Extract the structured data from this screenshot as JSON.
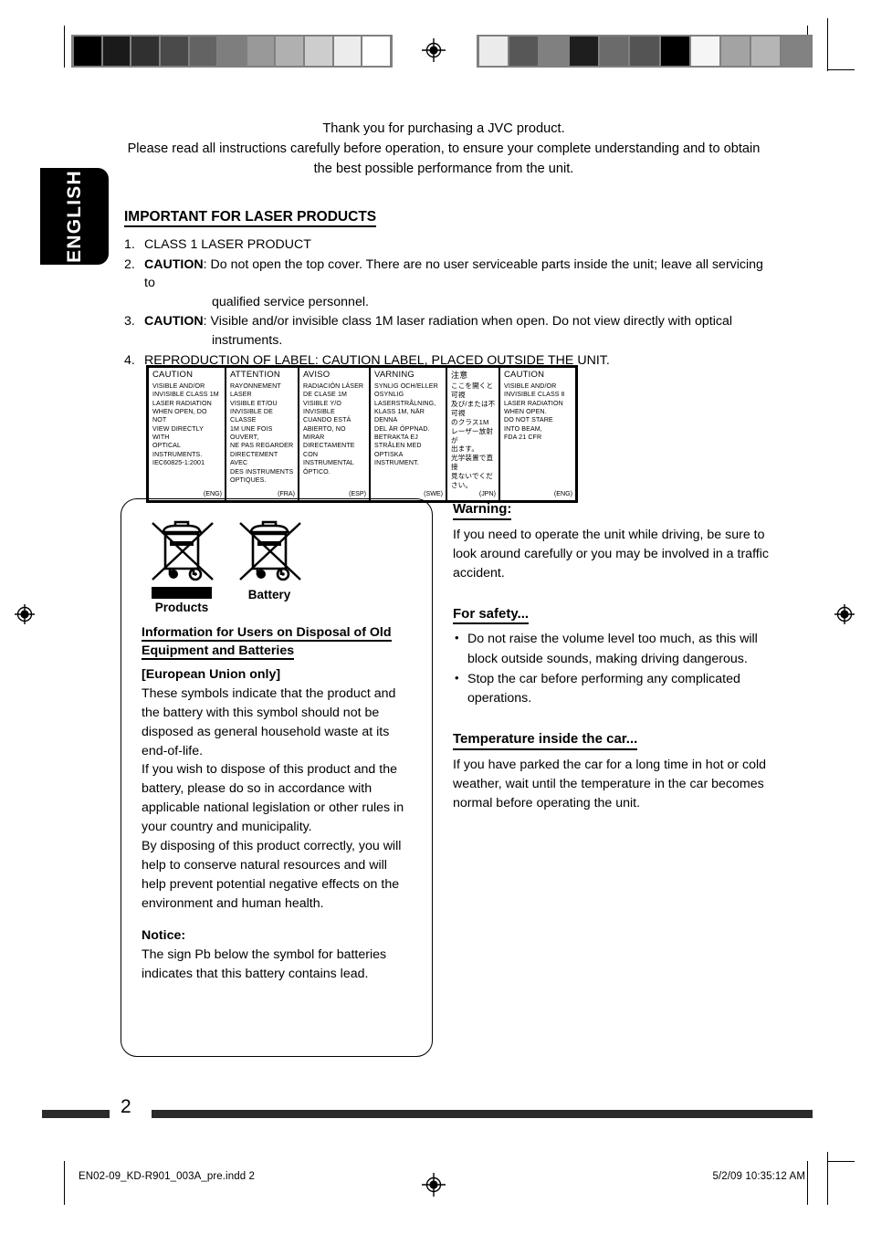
{
  "language_tab": {
    "label": "ENGLISH"
  },
  "intro": {
    "line1": "Thank you for purchasing a JVC product.",
    "line2": "Please read all instructions carefully before operation, to ensure your complete understanding and to obtain the best possible performance from the unit."
  },
  "laser_section": {
    "heading": "IMPORTANT FOR LASER PRODUCTS",
    "items": [
      {
        "num": "1.",
        "caution": "",
        "text": "CLASS 1 LASER PRODUCT",
        "indent": ""
      },
      {
        "num": "2.",
        "caution": "CAUTION",
        "text": ":   Do not open the top cover. There are no user serviceable parts inside the unit; leave all servicing to",
        "indent": "qualified service personnel."
      },
      {
        "num": "3.",
        "caution": "CAUTION",
        "text": ":   Visible and/or invisible class 1M laser radiation when open. Do not view directly with optical",
        "indent": "instruments."
      },
      {
        "num": "4.",
        "caution": "",
        "text": "REPRODUCTION OF LABEL: CAUTION LABEL, PLACED OUTSIDE THE UNIT.",
        "indent": ""
      }
    ]
  },
  "caution_label": {
    "cells": [
      {
        "title": "CAUTION",
        "body": "VISIBLE AND/OR\nINVISIBLE CLASS 1M\nLASER RADIATION\nWHEN OPEN, DO NOT\nVIEW DIRECTLY WITH\nOPTICAL INSTRUMENTS.\n  IEC60825-1:2001",
        "code": "(ENG)"
      },
      {
        "title": "ATTENTION",
        "body": "RAYONNEMENT LASER\nVISIBLE ET/OU\nINVISIBLE DE CLASSE\n1M UNE FOIS OUVERT,\nNE PAS REGARDER\nDIRECTEMENT AVEC\nDES INSTRUMENTS\nOPTIQUES.",
        "code": "(FRA)"
      },
      {
        "title": "AVISO",
        "body": "RADIACIÓN LÁSER\nDE CLASE 1M\nVISIBLE Y/O INVISIBLE\nCUANDO ESTÁ\nABIERTO, NO MIRAR\nDIRECTAMENTE\nCON INSTRUMENTAL\nÓPTICO.",
        "code": "(ESP)"
      },
      {
        "title": "VARNING",
        "body": "SYNLIG OCH/ELLER\nOSYNLIG\nLASERSTRÅLNING,\nKLASS 1M, NÄR DENNA\nDEL ÄR ÖPPNAD.\nBETRAKTA EJ\nSTRÅLEN MED OPTISKA\nINSTRUMENT.",
        "code": "(SWE)"
      },
      {
        "title": "注意",
        "body": "ここを開くと可視\n及び/または不可視\nのクラス1M\nレーザー放射が\n出ます。\n光学装置で直接\n見ないでください。",
        "code": "(JPN)"
      },
      {
        "title": "CAUTION",
        "body": "VISIBLE AND/OR\nINVISIBLE CLASS Ⅱ\nLASER RADIATION\nWHEN OPEN.\nDO NOT STARE\nINTO BEAM,\n  FDA 21 CFR",
        "code": "(ENG)"
      }
    ]
  },
  "disposal_box": {
    "symbol_products_label": "Products",
    "symbol_battery_label": "Battery",
    "heading": "Information for Users on Disposal of Old Equipment and Batteries",
    "subheading": "[European Union only]",
    "body": "These symbols indicate that the product and the battery with this symbol should not be disposed as general household waste at its end-of-life.\nIf you wish to dispose of this product and the battery, please do so in accordance with applicable national legislation or other rules in your country and municipality.\nBy disposing of this product correctly, you will help to conserve natural resources and will help prevent potential negative effects on the environment and human health.",
    "notice_heading": "Notice:",
    "notice_body": "The sign Pb below the symbol for batteries indicates that this battery contains lead."
  },
  "right_column": {
    "warning": {
      "heading": "Warning:",
      "body": "If you need to operate the unit while driving, be sure to look around carefully or you may be involved in a traffic accident."
    },
    "safety": {
      "heading": "For safety...",
      "bullets": [
        "Do not raise the volume level too much, as this will block outside sounds, making driving dangerous.",
        "Stop the car before performing any complicated operations."
      ]
    },
    "temperature": {
      "heading": "Temperature inside the car...",
      "body": "If you have parked the car for a long time in hot or cold weather, wait until the temperature in the car becomes normal before operating the unit."
    }
  },
  "footer": {
    "page_number": "2",
    "file_name": "EN02-09_KD-R901_003A_pre.indd   2",
    "timestamp": "5/2/09   10:35:12 AM"
  },
  "calibration": {
    "left_strip": [
      "#000000",
      "#1a1a1a",
      "#303030",
      "#4a4a4a",
      "#636363",
      "#7e7e7e",
      "#999999",
      "#b0b0b0",
      "#cdcdcd",
      "#ececec",
      "#ffffff"
    ],
    "right_strip": [
      "#ebebeb",
      "#575757",
      "#808080",
      "#1e1e1e",
      "#6b6b6b",
      "#545454",
      "#000000",
      "#f5f5f5",
      "#a3a3a3",
      "#b5b5b5",
      "#828282"
    ]
  }
}
